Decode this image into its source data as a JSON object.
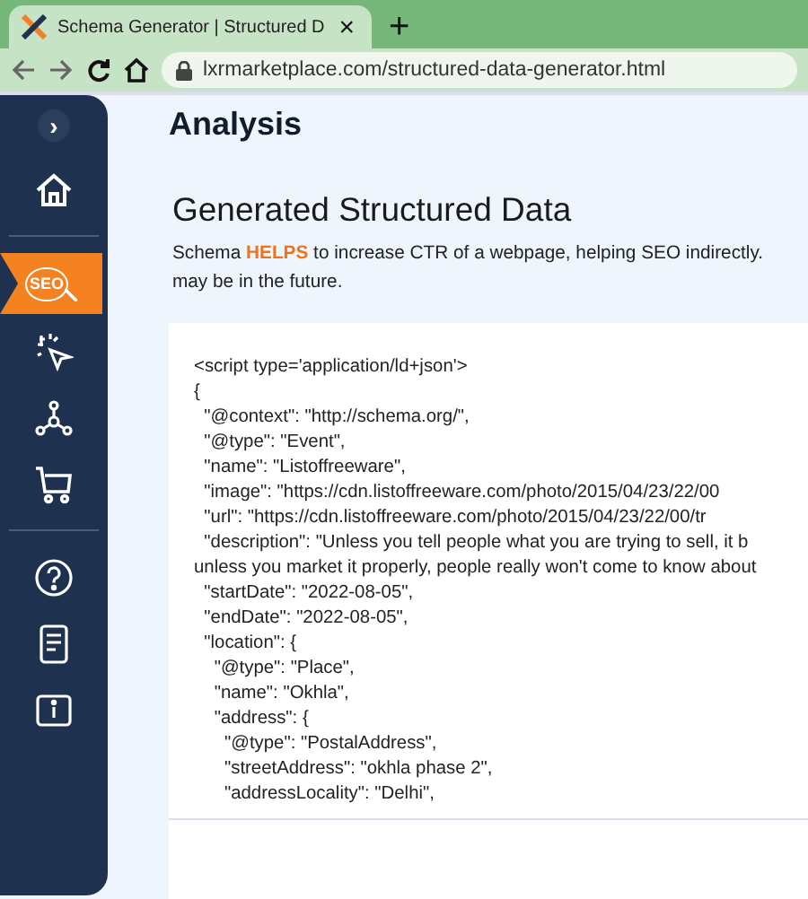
{
  "browser": {
    "tab_title": "Schema Generator | Structured D",
    "close": "×",
    "new_tab": "+",
    "url": "lxrmarketplace.com/structured-data-generator.html"
  },
  "sidebar": {
    "toggle": "›",
    "items": [
      {
        "kind": "home",
        "selected": false
      },
      {
        "kind": "divider"
      },
      {
        "kind": "seo",
        "selected": true,
        "label": "SEO"
      },
      {
        "kind": "dollar-cursor",
        "selected": false
      },
      {
        "kind": "network",
        "selected": false
      },
      {
        "kind": "cart",
        "selected": false
      },
      {
        "kind": "divider"
      },
      {
        "kind": "help",
        "selected": false
      },
      {
        "kind": "document",
        "selected": false
      },
      {
        "kind": "info",
        "selected": false
      }
    ]
  },
  "page": {
    "title": "Analysis",
    "heading": "Generated Structured Data",
    "description_lines": [
      "Schema **HELPS** to increase CTR of a webpage, helping SEO indirectly.",
      "may be in the future."
    ],
    "code_lines": [
      "<script type='application/ld+json'>",
      "{",
      "  \"@context\": \"http://schema.org/\",",
      "  \"@type\": \"Event\",",
      "  \"name\": \"Listoffreeware\",",
      "  \"image\": \"https://cdn.listoffreeware.com/photo/2015/04/23/22/00",
      "  \"url\": \"https://cdn.listoffreeware.com/photo/2015/04/23/22/00/tr",
      "  \"description\": \"Unless you tell people what you are trying to sell, it b",
      "unless you market it properly, people really won't come to know about",
      "  \"startDate\": \"2022-08-05\",",
      "  \"endDate\": \"2022-08-05\",",
      "  \"location\": {",
      "    \"@type\": \"Place\",",
      "    \"name\": \"Okhla\",",
      "    \"address\": {",
      "      \"@type\": \"PostalAddress\",",
      "      \"streetAddress\": \"okhla phase 2\",",
      "      \"addressLocality\": \"Delhi\","
    ]
  }
}
